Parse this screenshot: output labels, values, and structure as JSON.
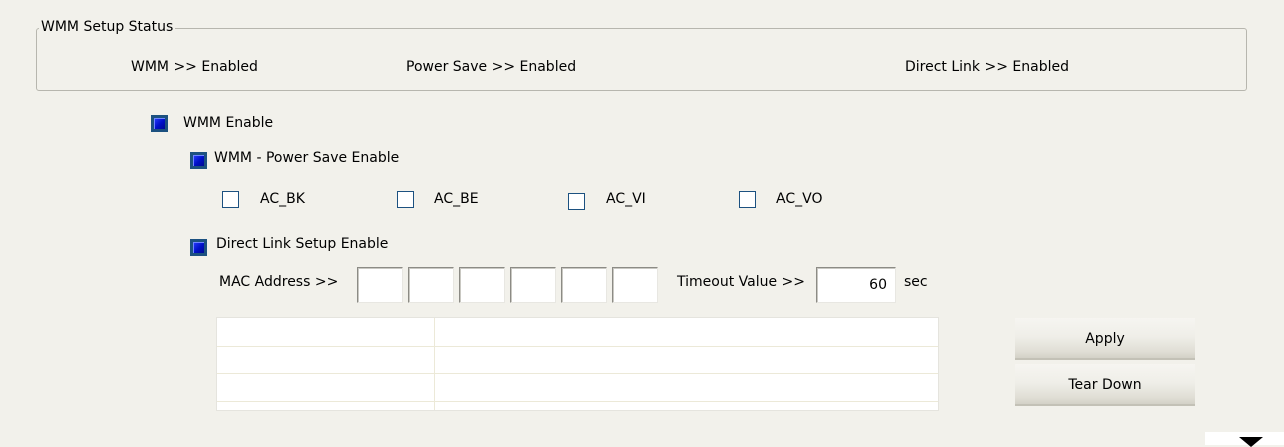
{
  "status_group": {
    "title": "WMM Setup Status",
    "wmm": "WMM >> Enabled",
    "power_save": "Power Save >> Enabled",
    "direct_link": "Direct Link >> Enabled"
  },
  "options": {
    "wmm_enable": {
      "label": "WMM Enable",
      "checked": true
    },
    "power_save_enable": {
      "label": "WMM - Power Save Enable",
      "checked": true
    },
    "ac": [
      {
        "label": "AC_BK",
        "checked": false
      },
      {
        "label": "AC_BE",
        "checked": false
      },
      {
        "label": "AC_VI",
        "checked": false
      },
      {
        "label": "AC_VO",
        "checked": false
      }
    ],
    "direct_link_enable": {
      "label": "Direct Link Setup Enable",
      "checked": true
    }
  },
  "direct_link": {
    "mac_label": "MAC Address >>",
    "mac_octets": [
      "",
      "",
      "",
      "",
      "",
      ""
    ],
    "timeout_label": "Timeout Value >>",
    "timeout_value": "60",
    "timeout_unit": "sec"
  },
  "buttons": {
    "apply": "Apply",
    "tear_down": "Tear Down"
  },
  "icons": {
    "scroll_down": "chevron-down-icon"
  },
  "colors": {
    "background": "#f2f1eb",
    "checkbox_border": "#1c5180",
    "checkbox_fill": "#0010c8"
  }
}
